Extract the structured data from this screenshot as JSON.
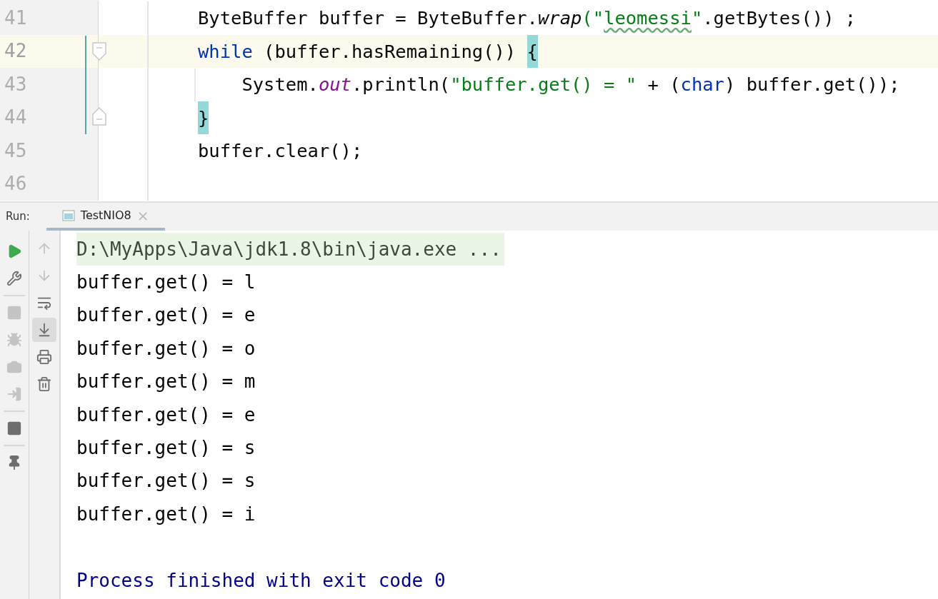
{
  "editor": {
    "lines": [
      {
        "number": "41",
        "current": false,
        "fold_start": false,
        "fold_end": false,
        "segments": [
          {
            "text": "ByteBuffer buffer = ByteBuffer.",
            "kind": "plain"
          },
          {
            "text": "wrap",
            "kind": "static-method"
          },
          {
            "text": "(\"",
            "kind": "plain-string"
          },
          {
            "text": "leomessi",
            "kind": "string-typo"
          },
          {
            "text": "\"",
            "kind": "plain-string"
          },
          {
            "text": ".getBytes()) ;",
            "kind": "plain"
          }
        ]
      },
      {
        "number": "42",
        "current": true,
        "fold_start": true,
        "fold_end": false,
        "segments": [
          {
            "text": "while",
            "kind": "keyword"
          },
          {
            "text": " (buffer.hasRemaining()) ",
            "kind": "plain"
          },
          {
            "text": "{",
            "kind": "brace-match"
          }
        ]
      },
      {
        "number": "43",
        "current": false,
        "fold_start": false,
        "fold_end": false,
        "segments": [
          {
            "text": "    System.",
            "kind": "plain"
          },
          {
            "text": "out",
            "kind": "static-field"
          },
          {
            "text": ".println(",
            "kind": "plain"
          },
          {
            "text": "\"buffer.get() = \"",
            "kind": "string"
          },
          {
            "text": " + (",
            "kind": "plain"
          },
          {
            "text": "char",
            "kind": "keyword"
          },
          {
            "text": ") buffer.get());",
            "kind": "plain"
          }
        ]
      },
      {
        "number": "44",
        "current": false,
        "fold_start": false,
        "fold_end": true,
        "segments": [
          {
            "text": "}",
            "kind": "brace-match"
          }
        ]
      },
      {
        "number": "45",
        "current": false,
        "fold_start": false,
        "fold_end": false,
        "segments": [
          {
            "text": "buffer.clear();",
            "kind": "plain"
          }
        ]
      },
      {
        "number": "46",
        "current": false,
        "fold_start": false,
        "fold_end": false
      }
    ]
  },
  "run_panel": {
    "label": "Run:",
    "tabs": [
      {
        "label": "TestNIO8",
        "close": "×",
        "selected": true
      }
    ],
    "toolbar_left": [
      {
        "disabled": false
      },
      {
        "disabled": false
      },
      {
        "disabled": true
      },
      {
        "disabled": true
      },
      {
        "disabled": true
      },
      {
        "disabled": true
      },
      {
        "disabled": false
      },
      {
        "disabled": false
      }
    ],
    "toolbar_right": [
      {
        "disabled": true,
        "selected": false
      },
      {
        "disabled": true,
        "selected": false
      },
      {
        "disabled": false,
        "selected": false
      },
      {
        "disabled": false,
        "selected": true
      },
      {
        "disabled": false,
        "selected": false
      },
      {
        "disabled": false,
        "selected": false
      }
    ],
    "console": [
      {
        "text": "D:\\MyApps\\Java\\jdk1.8\\bin\\java.exe ...",
        "kind": "command"
      },
      {
        "text": "buffer.get() = l",
        "kind": "output"
      },
      {
        "text": "buffer.get() = e",
        "kind": "output"
      },
      {
        "text": "buffer.get() = o",
        "kind": "output"
      },
      {
        "text": "buffer.get() = m",
        "kind": "output"
      },
      {
        "text": "buffer.get() = e",
        "kind": "output"
      },
      {
        "text": "buffer.get() = s",
        "kind": "output"
      },
      {
        "text": "buffer.get() = s",
        "kind": "output"
      },
      {
        "text": "buffer.get() = i",
        "kind": "output"
      },
      {
        "kind": "blank"
      },
      {
        "text": "Process finished with exit code 0",
        "kind": "exit"
      }
    ]
  }
}
